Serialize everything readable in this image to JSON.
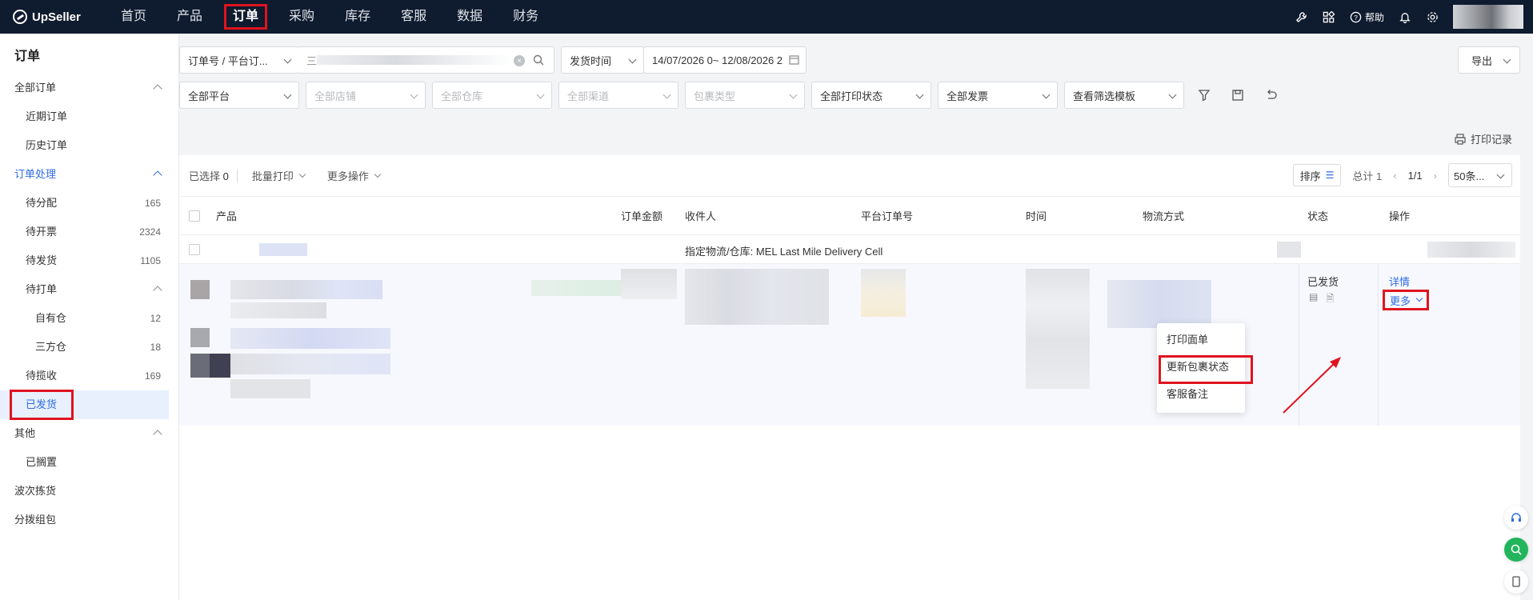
{
  "brand": {
    "name": "UpSeller"
  },
  "topnav": {
    "items": [
      "首页",
      "产品",
      "订单",
      "采购",
      "库存",
      "客服",
      "数据",
      "财务"
    ],
    "active_index": 2,
    "help_label": "帮助"
  },
  "sidebar": {
    "title": "订单",
    "rows": [
      {
        "label": "全部订单",
        "level": 0,
        "caret": true
      },
      {
        "label": "近期订单",
        "level": 1
      },
      {
        "label": "历史订单",
        "level": 1
      },
      {
        "label": "订单处理",
        "level": 0,
        "caret": true,
        "active_group": true
      },
      {
        "label": "待分配",
        "level": 1,
        "count": "165"
      },
      {
        "label": "待开票",
        "level": 1,
        "count": "2324"
      },
      {
        "label": "待发货",
        "level": 1,
        "count": "1105"
      },
      {
        "label": "待打单",
        "level": 1,
        "caret": true
      },
      {
        "label": "自有仓",
        "level": 2,
        "count": "12"
      },
      {
        "label": "三方仓",
        "level": 2,
        "count": "18"
      },
      {
        "label": "待揽收",
        "level": 1,
        "count": "169"
      },
      {
        "label": "已发货",
        "level": 1,
        "selected": true
      },
      {
        "label": "其他",
        "level": 0,
        "caret": true
      },
      {
        "label": "已搁置",
        "level": 1
      },
      {
        "label": "波次拣货",
        "level": 0
      },
      {
        "label": "分拨组包",
        "level": 0
      }
    ]
  },
  "filters": {
    "search_type": "订单号 / 平台订...",
    "search_value": "三",
    "date_type": "发货时间",
    "date_range": "14/07/2026 0~ 12/08/2026 2",
    "export_label": "导出",
    "row2": [
      {
        "label": "全部平台",
        "placeholder": false
      },
      {
        "label": "全部店铺",
        "placeholder": true
      },
      {
        "label": "全部仓库",
        "placeholder": true
      },
      {
        "label": "全部渠道",
        "placeholder": true
      },
      {
        "label": "包裹类型",
        "placeholder": true
      },
      {
        "label": "全部打印状态",
        "placeholder": false
      },
      {
        "label": "全部发票",
        "placeholder": false
      },
      {
        "label": "查看筛选模板",
        "placeholder": false
      }
    ],
    "print_log_label": "打印记录"
  },
  "toolbar": {
    "selected_label": "已选择",
    "selected_count": "0",
    "batch_print": "批量打印",
    "more_actions": "更多操作",
    "sort_label": "排序",
    "total_label": "总计 1",
    "page": "1/1",
    "page_size": "50条..."
  },
  "table": {
    "headers": {
      "product": "产品",
      "amount": "订单金额",
      "receiver": "收件人",
      "platform_order": "平台订单号",
      "time": "时间",
      "logistics": "物流方式",
      "status": "状态",
      "action": "操作"
    },
    "group_label": "指定物流/仓库: MEL Last Mile Delivery Cell",
    "row": {
      "status": "已发货",
      "detail": "详情",
      "more": "更多"
    }
  },
  "dropdown": {
    "items": [
      "打印面单",
      "更新包裹状态",
      "客服备注"
    ],
    "highlight_index": 1
  },
  "colors": {
    "accent": "#2f6be4",
    "highlight": "#e0131f",
    "nav_bg": "#0f1b2e"
  }
}
